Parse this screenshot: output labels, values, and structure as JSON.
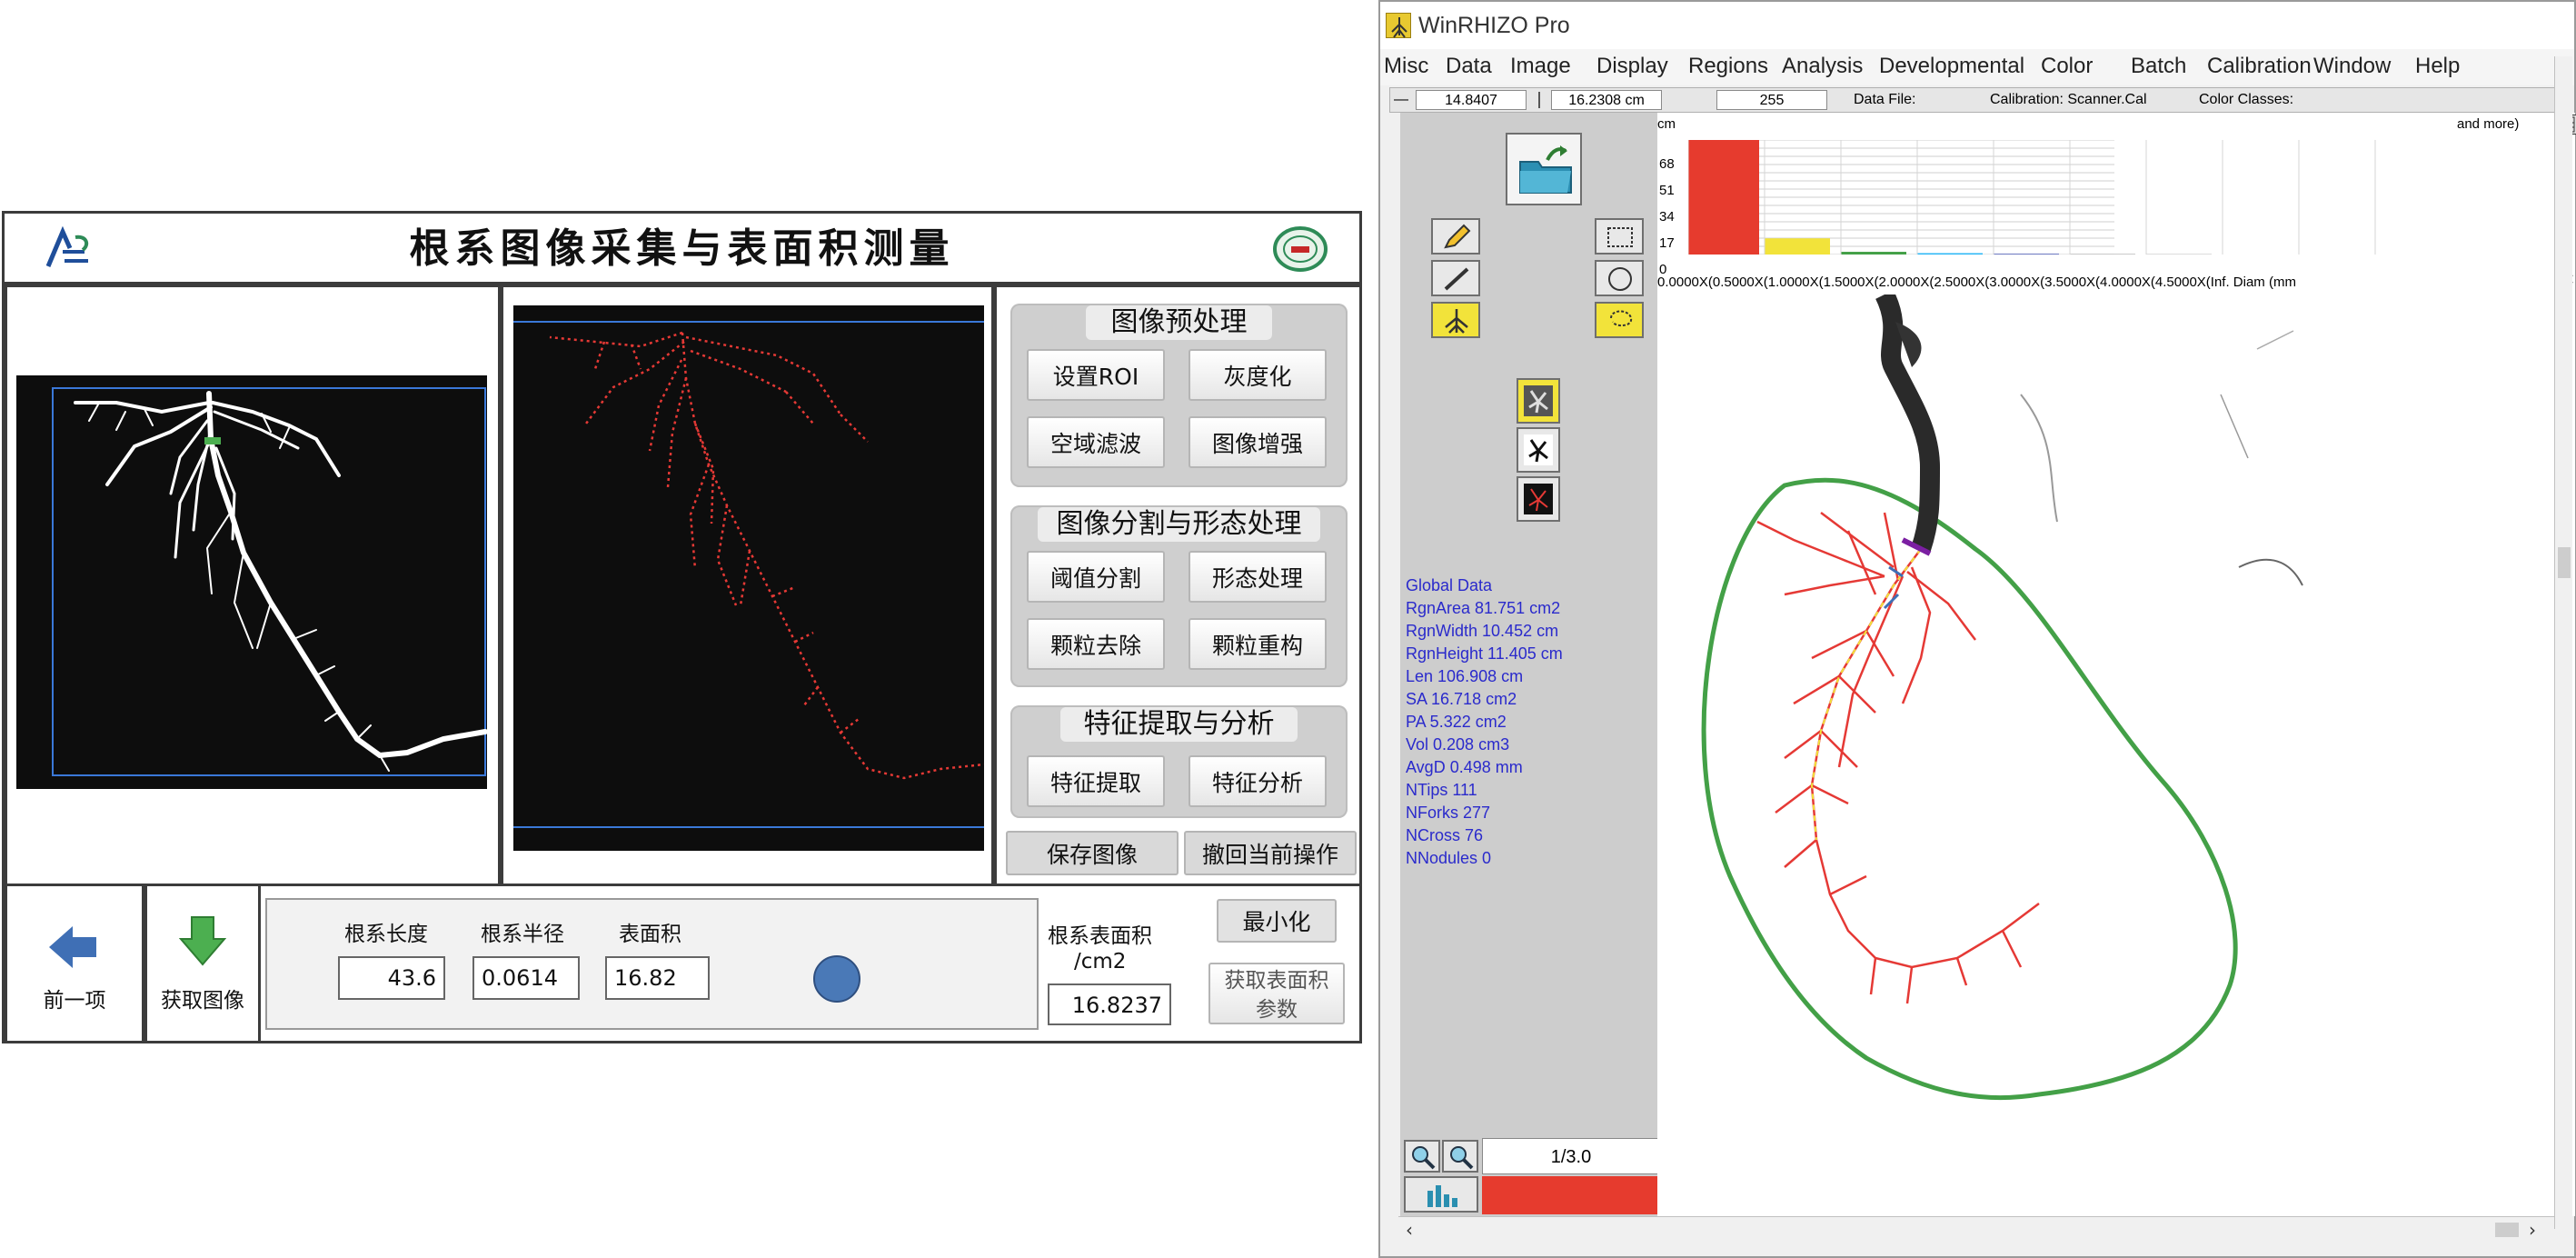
{
  "left_app": {
    "title": "根系图像采集与表面积测量",
    "groups": {
      "preprocess": {
        "title": "图像预处理",
        "buttons": [
          "设置ROI",
          "灰度化",
          "空域滤波",
          "图像增强"
        ]
      },
      "segmentation": {
        "title": "图像分割与形态处理",
        "buttons": [
          "阈值分割",
          "形态处理",
          "颗粒去除",
          "颗粒重构"
        ]
      },
      "features": {
        "title": "特征提取与分析",
        "buttons": [
          "特征提取",
          "特征分析"
        ]
      }
    },
    "save_image": "保存图像",
    "undo": "撤回当前操作",
    "prev_label": "前一项",
    "acquire_label": "获取图像",
    "length_label": "根系长度",
    "length_value": "43.6",
    "radius_label": "根系半径",
    "radius_value": "0.0614",
    "area_label": "表面积",
    "area_value": "16.82",
    "surface_label_line1": "根系表面积",
    "surface_label_line2": "/cm2",
    "surface_value": "16.8237",
    "minimize": "最小化",
    "get_params_line1": "获取表面积",
    "get_params_line2": "参数",
    "colors": {
      "indicator": "#4a79b7",
      "arrow": "#3f6fb5",
      "download": "#4caf50"
    }
  },
  "right_app": {
    "window_title": "WinRHIZO Pro",
    "menu": [
      "Misc",
      "Data",
      "Image",
      "Display",
      "Regions",
      "Analysis",
      "Developmental",
      "Color",
      "Batch",
      "Calibration",
      "Window",
      "Help"
    ],
    "toolbar": {
      "x_value": "14.8407",
      "y_value": "16.2308 cm",
      "threshold": "255",
      "data_file": "Data File:",
      "calibration": "Calibration: Scanner.Cal",
      "color_classes": "Color Classes:"
    },
    "histogram": {
      "unit": "cm",
      "more": "and more)",
      "y_ticks": [
        "68",
        "51",
        "34",
        "17",
        "0"
      ],
      "x_labels": "0.0000X(0.5000X(1.0000X(1.5000X(2.0000X(2.5000X(3.0000X(3.5000X(4.0000X(4.5000X(Inf.  Diam (mm",
      "bars": [
        85,
        12,
        2,
        1,
        0.5,
        0.3,
        0.2,
        0,
        0,
        0
      ],
      "colors": [
        "#e63b2e",
        "#f2e33a",
        "#43a047",
        "#29b6f6",
        "#3949ab",
        "#888888",
        "#888888",
        "#888888",
        "#888888",
        "#888888"
      ]
    },
    "global_data": {
      "title": "Global Data",
      "lines": [
        "RgnArea 81.751 cm2",
        "RgnWidth 10.452 cm",
        "RgnHeight 11.405 cm",
        "Len  106.908 cm",
        "SA  16.718 cm2",
        "PA  5.322 cm2",
        "Vol  0.208 cm3",
        "AvgD  0.498 mm",
        "NTips   111",
        "NForks   277",
        "NCross   76",
        "NNodules   0"
      ]
    },
    "page_indicator": "1/3.0",
    "colors": {
      "status_bar": "#e63b2e",
      "region_outline": "#4caf50",
      "root_color": "#e53935"
    }
  }
}
